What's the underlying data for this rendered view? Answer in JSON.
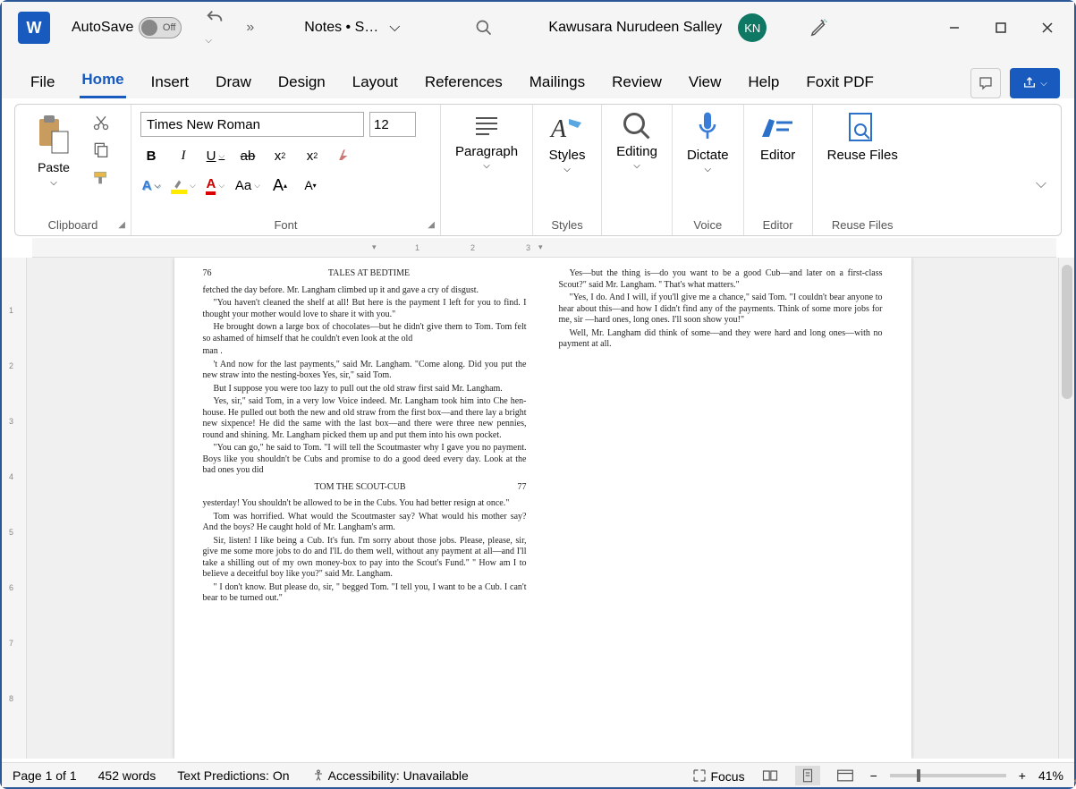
{
  "titlebar": {
    "word_icon": "W",
    "autosave": "AutoSave",
    "toggle_state": "Off",
    "doc_name": "Notes • S…",
    "username": "Kawusara Nurudeen Salley",
    "avatar": "KN"
  },
  "tabs": {
    "file": "File",
    "home": "Home",
    "insert": "Insert",
    "draw": "Draw",
    "design": "Design",
    "layout": "Layout",
    "references": "References",
    "mailings": "Mailings",
    "review": "Review",
    "view": "View",
    "help": "Help",
    "foxit": "Foxit PDF"
  },
  "ribbon": {
    "paste": "Paste",
    "clipboard": "Clipboard",
    "font_name": "Times New Roman",
    "font_size": "12",
    "font": "Font",
    "paragraph": "Paragraph",
    "styles": "Styles",
    "editing": "Editing",
    "dictate": "Dictate",
    "voice": "Voice",
    "editor": "Editor",
    "reuse_files": "Reuse Files",
    "reuse_files_label": "Reuse Files",
    "aa": "Aa"
  },
  "document": {
    "left_header_num": "76",
    "left_header_title": "TALES AT BEDTIME",
    "right_header_title": "TOM THE SCOUT-CUB",
    "right_header_num": "77",
    "p1": "fetched the day before. Mr. Langham climbed up it and gave a cry of disgust.",
    "p2": "\"You haven't cleaned the shelf at all! But here is the payment I left for you to find. I thought your mother would love to share it with you.\"",
    "p3": "He brought down a large box of chocolates—but he didn't give them to Tom. Tom felt so ashamed of himself that he couldn't even look at the old",
    "p3b": "man .",
    "p4": "'t And now for the last payments,\" said Mr. Langham. \"Come along. Did you put the new straw into the nesting-boxes Yes, sir,\" said Tom.",
    "p5": "But I suppose you were too lazy to pull out the old straw first said Mr. Langham.",
    "p6": "Yes, sir,\" said Tom, in a very low Voice indeed. Mr. Langham took him into Che hen-house. He pulled out both the new and old straw from the first box—and there lay a bright new sixpence! He did the same with the last box—and there were three new pennies, round and shining. Mr. Langham picked them up and put them into his own pocket.",
    "p7": "\"You can go,\" he said to Tom. \"I will tell the Scoutmaster why I gave you no payment. Boys like you shouldn't be Cubs and promise to do a good deed every day. Look at the bad ones you did",
    "p8": "yesterday! You shouldn't be allowed to be in the Cubs. You had better resign at once.\"",
    "p9": "Tom was horrified. What would the Scoutmaster say? What would his mother say? And the boys? He caught hold of Mr. Langham's arm.",
    "p10": "Sir, listen! I like being a Cub. It's fun. I'm sorry about those jobs. Please, please, sir, give me some more jobs to do and I'lL do them well, without any payment at all—and I'll take a shilling out of my own money-box to pay into the Scout's Fund.\" '' How am I to believe a deceitful boy like you?\" said Mr. Langham.",
    "p11": "\" I don't know. But please do, sir, \" begged Tom. \"I tell you, I want to be a Cub. I can't bear to be turned out.\"",
    "r1": "Yes—but the thing is—do you want to be a good Cub—and later on a first-class Scout?\" said Mr. Langham. '' That's what matters.\"",
    "r2": "\"Yes, I do. And I will, if you'll give me a chance,\" said Tom. \"I couldn't bear anyone to hear about this—and how I didn't find any of the payments. Think of some more jobs for me, sir —hard ones, long ones. I'll soon show you!\"",
    "r3": "Well, Mr. Langham did think of some—and they were hard and long ones—with no payment at all."
  },
  "statusbar": {
    "page": "Page 1 of 1",
    "words": "452 words",
    "predictions": "Text Predictions: On",
    "accessibility": "Accessibility: Unavailable",
    "focus": "Focus",
    "zoom": "41%"
  }
}
